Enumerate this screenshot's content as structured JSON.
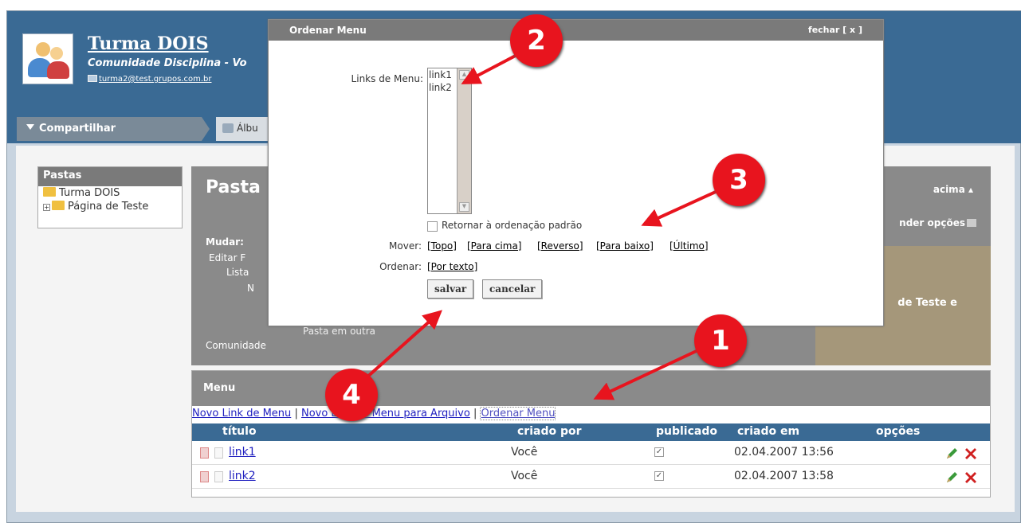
{
  "header": {
    "title": "Turma DOIS",
    "subtitle": "Comunidade Disciplina - Vo",
    "email": "turma2@test.grupos.com.br"
  },
  "nav": {
    "share": "Compartilhar",
    "album": "Álbu"
  },
  "sidebar": {
    "title": "Pastas",
    "items": [
      {
        "label": "Turma DOIS"
      },
      {
        "label": "Página de Teste"
      }
    ]
  },
  "main": {
    "title": "Pasta",
    "acima": "acima ▴",
    "expandir": "nder opções",
    "mudar": "Mudar:",
    "editar": "Editar F",
    "lista": "Lista",
    "pagina": "N",
    "teste_e": "de Teste e",
    "outra": "Pasta em outra",
    "comunidade": "Comunidade"
  },
  "menu": {
    "title": "Menu",
    "links": {
      "novo": "Novo Link de Menu",
      "sep": "|",
      "arquivo": "Novo Link de Menu para Arquivo",
      "ordenar": "Ordenar Menu"
    },
    "columns": {
      "titulo": "título",
      "criado_por": "criado por",
      "publicado": "publicado",
      "criado_em": "criado em",
      "opcoes": "opções"
    },
    "rows": [
      {
        "titulo": "link1",
        "criado_por": "Você",
        "publicado": "✓",
        "criado_em": "02.04.2007 13:56"
      },
      {
        "titulo": "link2",
        "criado_por": "Você",
        "publicado": "✓",
        "criado_em": "02.04.2007 13:58"
      }
    ]
  },
  "modal": {
    "title": "Ordenar Menu",
    "close": "fechar [ x ]",
    "links_label": "Links de Menu:",
    "options": [
      "link1",
      "link2"
    ],
    "retornar": "Retornar à ordenação padrão",
    "mover_label": "Mover:",
    "mover": {
      "topo": "[Topo]",
      "cima": "[Para cima]",
      "reverso": "[Reverso]",
      "baixo": "[Para baixo]",
      "ultimo": "[Último]"
    },
    "ordenar_label": "Ordenar:",
    "por_texto": "[Por texto]",
    "salvar": "salvar",
    "cancelar": "cancelar"
  },
  "annotations": {
    "c1": "1",
    "c2": "2",
    "c3": "3",
    "c4": "4",
    "color": "#e8141e"
  }
}
